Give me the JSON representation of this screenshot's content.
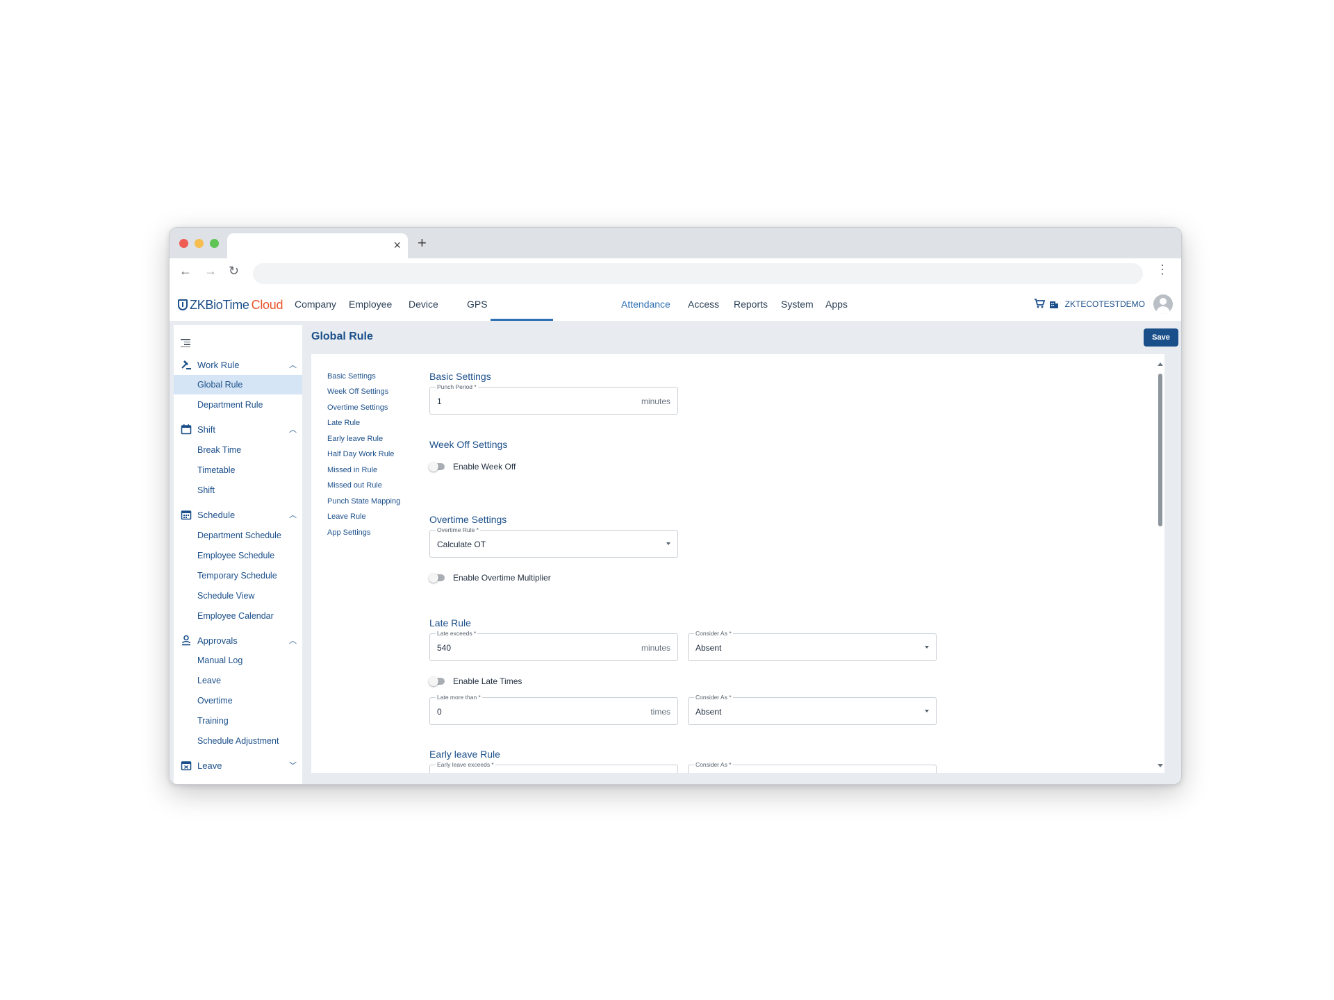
{
  "app": {
    "logo_main": "ZKBioTime",
    "logo_accent": "Cloud",
    "nav": [
      "Company",
      "Employee",
      "Device",
      "GPS",
      "Attendance",
      "Access",
      "Reports",
      "System",
      "Apps"
    ],
    "active_nav": "Attendance",
    "company": "ZKTECOTESTDEMO",
    "accent_color": "#1b4f8a",
    "link_color": "#2d6fb2",
    "logo_accent_color": "#e9562c"
  },
  "sidebar": {
    "groups": [
      {
        "label": "Work Rule",
        "icon": "gavel-icon",
        "expanded": true,
        "items": [
          "Global Rule",
          "Department Rule"
        ]
      },
      {
        "label": "Shift",
        "icon": "calendar-icon",
        "expanded": true,
        "items": [
          "Break Time",
          "Timetable",
          "Shift"
        ]
      },
      {
        "label": "Schedule",
        "icon": "calendar-grid-icon",
        "expanded": true,
        "items": [
          "Department Schedule",
          "Employee Schedule",
          "Temporary Schedule",
          "Schedule View",
          "Employee Calendar"
        ]
      },
      {
        "label": "Approvals",
        "icon": "person-stamp-icon",
        "expanded": true,
        "items": [
          "Manual Log",
          "Leave",
          "Overtime",
          "Training",
          "Schedule Adjustment"
        ]
      },
      {
        "label": "Leave",
        "icon": "calendar-x-icon",
        "expanded": false,
        "items": []
      }
    ],
    "active_item": "Global Rule"
  },
  "page": {
    "title": "Global Rule",
    "save_label": "Save",
    "anchors": [
      "Basic Settings",
      "Week Off Settings",
      "Overtime Settings",
      "Late Rule",
      "Early leave Rule",
      "Half Day Work Rule",
      "Missed in Rule",
      "Missed out Rule",
      "Punch State Mapping",
      "Leave Rule",
      "App Settings"
    ]
  },
  "form": {
    "basic": {
      "title": "Basic Settings",
      "punch_period": {
        "label": "Punch Period *",
        "value": "1",
        "unit": "minutes"
      }
    },
    "week_off": {
      "title": "Week Off Settings",
      "toggle_label": "Enable Week Off",
      "enabled": false
    },
    "overtime": {
      "title": "Overtime Settings",
      "rule": {
        "label": "Overtime Rule *",
        "value": "Calculate OT"
      },
      "toggle_label": "Enable Overtime Multiplier",
      "enabled": false
    },
    "late": {
      "title": "Late Rule",
      "exceeds": {
        "label": "Late exceeds *",
        "value": "540",
        "unit": "minutes"
      },
      "consider": {
        "label": "Consider As *",
        "value": "Absent"
      },
      "toggle_label": "Enable Late Times",
      "enabled": false,
      "more_than": {
        "label": "Late more than *",
        "value": "0",
        "unit": "times"
      },
      "consider2": {
        "label": "Consider As *",
        "value": "Absent"
      }
    },
    "early": {
      "title": "Early leave Rule",
      "exceeds": {
        "label": "Early leave exceeds *"
      },
      "consider": {
        "label": "Consider As *"
      }
    }
  }
}
